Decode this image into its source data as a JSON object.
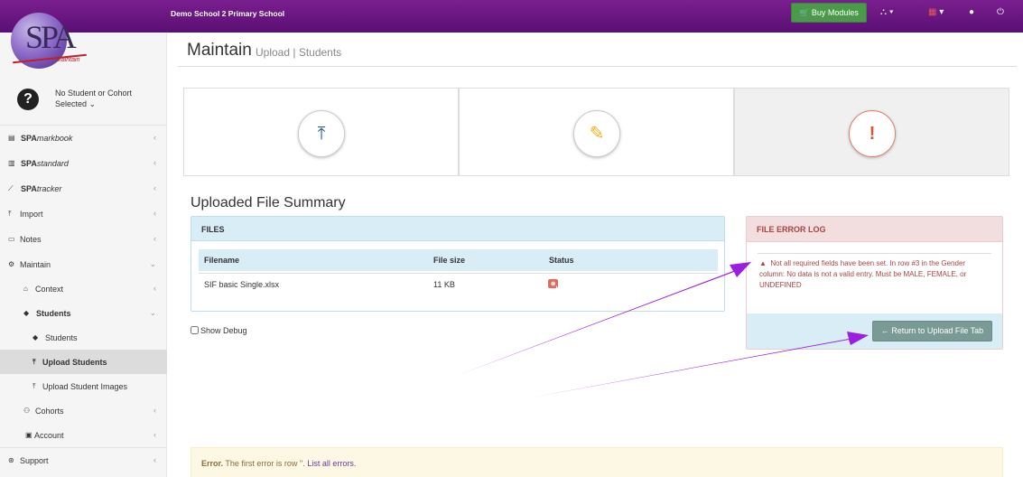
{
  "topbar": {
    "school_name": "Demo School 2 Primary School",
    "buy_modules": "🛒 Buy Modules",
    "icons": [
      "sitemap-icon",
      "calendar-icon",
      "user-icon",
      "power-icon"
    ]
  },
  "sidebar": {
    "logo_sub": "Maintain",
    "student_line1": "No Student or Cohort",
    "student_line2": "Selected",
    "items": [
      {
        "prefix": "SPA",
        "suffix": "markbook"
      },
      {
        "prefix": "SPA",
        "suffix": "standard"
      },
      {
        "prefix": "SPA",
        "suffix": "tracker"
      },
      {
        "label": "Import"
      },
      {
        "label": "Notes"
      },
      {
        "label": "Maintain"
      },
      {
        "label": "Context"
      },
      {
        "label": "Students"
      },
      {
        "label": "Students"
      },
      {
        "label": "Upload Students"
      },
      {
        "label": "Upload Student Images"
      },
      {
        "label": "Cohorts"
      },
      {
        "label": "Account"
      },
      {
        "label": "Support"
      }
    ]
  },
  "header": {
    "title": "Maintain",
    "subtitle": "Upload | Students"
  },
  "summary": {
    "title": "Uploaded File Summary",
    "files_heading": "FILES",
    "columns": [
      "Filename",
      "File size",
      "Status"
    ],
    "rows": [
      {
        "filename": "SIF basic Single.xlsx",
        "size": "11 KB",
        "status": "HAS ERRORS"
      }
    ],
    "show_debug": "Show Debug"
  },
  "error_log": {
    "heading": "FILE ERROR LOG",
    "message": "Not all required fields have been set. In row #3 in the Gender column: No data is not a valid entry. Must be MALE, FEMALE, or UNDEFINED",
    "return_button": "Return to Upload File Tab"
  },
  "error_bar": {
    "label": "Error.",
    "text": "The first error is row ''.",
    "link": "List all errors."
  },
  "colors": {
    "topbar": "#6a1a80",
    "buy_button": "#4a9a4a",
    "error_text": "#a94442",
    "arrow": "#9b1fe0"
  }
}
